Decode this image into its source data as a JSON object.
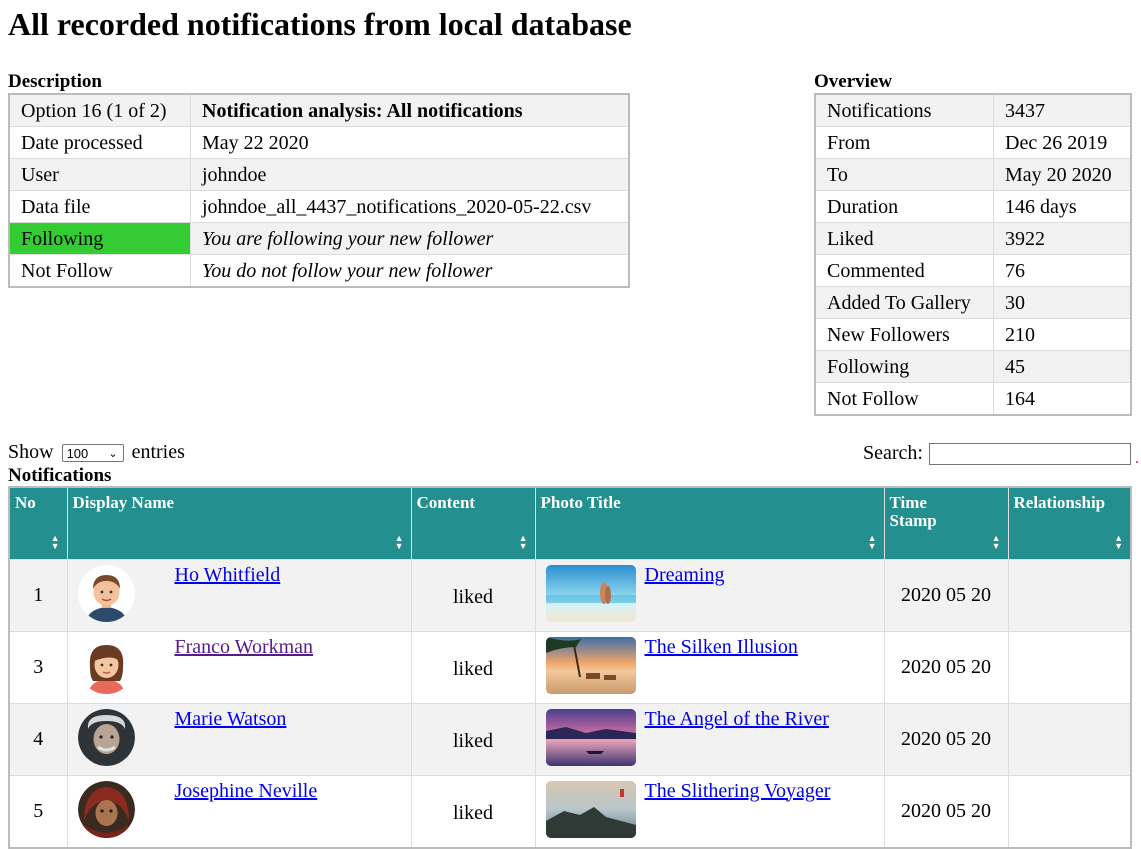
{
  "page": {
    "title": "All recorded notifications from local database"
  },
  "description": {
    "caption": "Description",
    "rows": [
      {
        "label": "Option 16 (1 of 2)",
        "value": "Notification analysis: All notifications"
      },
      {
        "label": "Date processed",
        "value": "May 22 2020"
      },
      {
        "label": "User",
        "value": "johndoe"
      },
      {
        "label": "Data file",
        "value": "johndoe_all_4437_notifications_2020-05-22.csv"
      },
      {
        "label": "Following",
        "value": "You are following your new follower"
      },
      {
        "label": "Not Follow",
        "value": "You do not follow your new follower"
      }
    ],
    "following_color": "#33cc33"
  },
  "overview": {
    "caption": "Overview",
    "rows": [
      {
        "label": "Notifications",
        "value": "3437"
      },
      {
        "label": "From",
        "value": "Dec 26 2019"
      },
      {
        "label": "To",
        "value": "May 20 2020"
      },
      {
        "label": "Duration",
        "value": "146 days"
      },
      {
        "label": "Liked",
        "value": "3922"
      },
      {
        "label": "Commented",
        "value": "76"
      },
      {
        "label": "Added To Gallery",
        "value": "30"
      },
      {
        "label": "New Followers",
        "value": "210"
      },
      {
        "label": "Following",
        "value": "45"
      },
      {
        "label": "Not Follow",
        "value": "164"
      }
    ]
  },
  "controls": {
    "show_label": "Show",
    "entries_value": "100",
    "entries_label": "entries",
    "search_label": "Search:",
    "search_value": ""
  },
  "notifications": {
    "caption": "Notifications",
    "header_color": "#248f8f",
    "columns": [
      "No",
      "Display Name",
      "Content",
      "Photo Title",
      "Time Stamp",
      "Relationship"
    ],
    "rows": [
      {
        "no": "1",
        "name": "Ho Whitfield",
        "content": "liked",
        "photo": "Dreaming",
        "time": "2020 05 20",
        "relationship": ""
      },
      {
        "no": "3",
        "name": "Franco Workman",
        "content": "liked",
        "photo": "The Silken Illusion",
        "time": "2020 05 20",
        "relationship": ""
      },
      {
        "no": "4",
        "name": "Marie Watson",
        "content": "liked",
        "photo": "The Angel of the River",
        "time": "2020 05 20",
        "relationship": ""
      },
      {
        "no": "5",
        "name": "Josephine Neville",
        "content": "liked",
        "photo": "The Slithering Voyager",
        "time": "2020 05 20",
        "relationship": ""
      }
    ]
  }
}
